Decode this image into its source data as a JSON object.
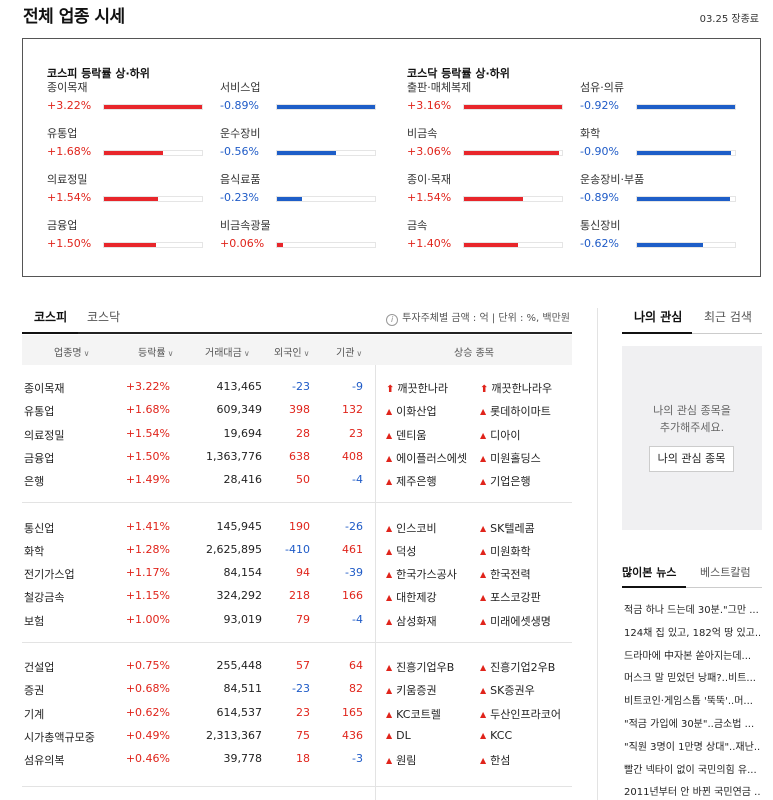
{
  "header": {
    "title": "전체 업종 시세",
    "date": "03.25 장종료"
  },
  "summary": {
    "kospi": {
      "title": "코스피 등락률 상·하위",
      "up": [
        {
          "name": "종이목재",
          "rate": "+3.22%",
          "level": 1.0
        },
        {
          "name": "유통업",
          "rate": "+1.68%",
          "level": 0.6
        },
        {
          "name": "의료정밀",
          "rate": "+1.54%",
          "level": 0.55
        },
        {
          "name": "금융업",
          "rate": "+1.50%",
          "level": 0.53
        }
      ],
      "down": [
        {
          "name": "서비스업",
          "rate": "-0.89%",
          "level": 1.0
        },
        {
          "name": "운수장비",
          "rate": "-0.56%",
          "level": 0.6
        },
        {
          "name": "음식료품",
          "rate": "-0.23%",
          "level": 0.25
        },
        {
          "name": "비금속광물",
          "rate": "+0.06%",
          "level": 0.06
        }
      ]
    },
    "kosdaq": {
      "title": "코스닥 등락률 상·하위",
      "up": [
        {
          "name": "출판·매체복제",
          "rate": "+3.16%",
          "level": 1.0
        },
        {
          "name": "비금속",
          "rate": "+3.06%",
          "level": 0.97
        },
        {
          "name": "종이·목재",
          "rate": "+1.54%",
          "level": 0.6
        },
        {
          "name": "금속",
          "rate": "+1.40%",
          "level": 0.55
        }
      ],
      "down": [
        {
          "name": "섬유·의류",
          "rate": "-0.92%",
          "level": 1.0
        },
        {
          "name": "화학",
          "rate": "-0.90%",
          "level": 0.96
        },
        {
          "name": "운송장비·부품",
          "rate": "-0.89%",
          "level": 0.95
        },
        {
          "name": "통신장비",
          "rate": "-0.62%",
          "level": 0.67
        }
      ]
    }
  },
  "table": {
    "tabs": [
      "코스피",
      "코스닥"
    ],
    "unit_note": "투자주체별 금액 : 억  |  단위 : %, 백만원",
    "headers": [
      "업종명",
      "등락률",
      "거래대금",
      "외국인",
      "기관",
      "상승 종목"
    ],
    "rows": [
      {
        "name": "종이목재",
        "rate": "+3.22%",
        "volume": "413,465",
        "foreign": "-23",
        "inst": "-9",
        "s1": "깨끗한나라",
        "s2": "깨끗한나라우",
        "mark": "arrow"
      },
      {
        "name": "유통업",
        "rate": "+1.68%",
        "volume": "609,349",
        "foreign": "398",
        "inst": "132",
        "s1": "이화산업",
        "s2": "롯데하이마트"
      },
      {
        "name": "의료정밀",
        "rate": "+1.54%",
        "volume": "19,694",
        "foreign": "28",
        "inst": "23",
        "s1": "덴티움",
        "s2": "디아이"
      },
      {
        "name": "금융업",
        "rate": "+1.50%",
        "volume": "1,363,776",
        "foreign": "638",
        "inst": "408",
        "s1": "에이플러스에셋",
        "s2": "미원홀딩스"
      },
      {
        "name": "은행",
        "rate": "+1.49%",
        "volume": "28,416",
        "foreign": "50",
        "inst": "-4",
        "s1": "제주은행",
        "s2": "기업은행"
      },
      {
        "name": "통신업",
        "rate": "+1.41%",
        "volume": "145,945",
        "foreign": "190",
        "inst": "-26",
        "s1": "인스코비",
        "s2": "SK텔레콤"
      },
      {
        "name": "화학",
        "rate": "+1.28%",
        "volume": "2,625,895",
        "foreign": "-410",
        "inst": "461",
        "s1": "덕성",
        "s2": "미원화학"
      },
      {
        "name": "전기가스업",
        "rate": "+1.17%",
        "volume": "84,154",
        "foreign": "94",
        "inst": "-39",
        "s1": "한국가스공사",
        "s2": "한국전력"
      },
      {
        "name": "철강금속",
        "rate": "+1.15%",
        "volume": "324,292",
        "foreign": "218",
        "inst": "166",
        "s1": "대한제강",
        "s2": "포스코강판"
      },
      {
        "name": "보험",
        "rate": "+1.00%",
        "volume": "93,019",
        "foreign": "79",
        "inst": "-4",
        "s1": "삼성화재",
        "s2": "미래에셋생명"
      },
      {
        "name": "건설업",
        "rate": "+0.75%",
        "volume": "255,448",
        "foreign": "57",
        "inst": "64",
        "s1": "진흥기업우B",
        "s2": "진흥기업2우B"
      },
      {
        "name": "증권",
        "rate": "+0.68%",
        "volume": "84,511",
        "foreign": "-23",
        "inst": "82",
        "s1": "키움증권",
        "s2": "SK증권우"
      },
      {
        "name": "기계",
        "rate": "+0.62%",
        "volume": "614,537",
        "foreign": "23",
        "inst": "165",
        "s1": "KC코트렐",
        "s2": "두산인프라코어"
      },
      {
        "name": "시가총액규모중",
        "rate": "+0.49%",
        "volume": "2,313,367",
        "foreign": "75",
        "inst": "436",
        "s1": "DL",
        "s2": "KCC"
      },
      {
        "name": "섬유의복",
        "rate": "+0.46%",
        "volume": "39,778",
        "foreign": "18",
        "inst": "-3",
        "s1": "원림",
        "s2": "한섬"
      }
    ]
  },
  "sidebar": {
    "tabs": [
      "나의 관심",
      "최근 검색"
    ],
    "empty_message": "나의 관심 종목을\n추가해주세요.",
    "button": "나의 관심 종목",
    "news_tabs": [
      "많이본 뉴스",
      "베스트칼럼"
    ],
    "news": [
      "적금 하나 드는데 30분.\"그만 ...",
      "124채 집 있고, 182억 땅 있고...",
      "드라마에 中자본 쏟아지는데...",
      "머스크 말 믿었던 낭패?..비트...",
      "비트코인·게임스톱 '뚝뚝'..머...",
      "\"적금 가입에 30분\"..금소법 ...",
      "\"직원 3명이 1만명 상대\"..재난...",
      "빨간 넥타이 없이 국민의힘 유...",
      "2011년부터 안 바뀐 국민연금 ..."
    ]
  },
  "colors": {
    "up": "#e0241b",
    "down": "#1f5bc7",
    "bar_up": "#e8262b",
    "bar_down": "#1e5ec8"
  },
  "icons": {
    "info": "info-icon",
    "sort": "chevron-down-icon",
    "up_arrow": "arrow-up-icon",
    "triangle": "triangle-up-icon"
  }
}
